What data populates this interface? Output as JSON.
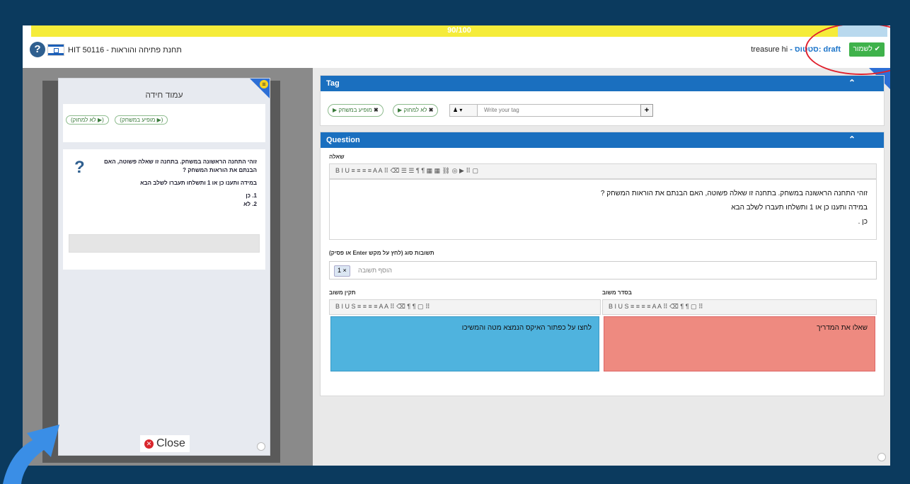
{
  "progress": {
    "text": "90/100",
    "value": 0.9
  },
  "header": {
    "hit_title": "HIT תחנת פתיחה והוראות - 50116",
    "status_prefix": "treasure hi",
    "status_draft": " - סטטוס: draft",
    "save_label": "לשמור ✔"
  },
  "preview": {
    "title": "עמוד חידה",
    "tag_pills": [
      "(לא למחוק ▶)",
      "(מופיע במשחק ▶)"
    ],
    "question_lines": [
      "זוהי התחנה הראשונה במשחק. בתחנה זו שאלה פשוטה, האם הבנתם את הוראות המשחק ?",
      "במידה ותענו כן או 1 ותשלחו תעברו לשלב הבא",
      "1. כן",
      "2. לא"
    ],
    "close_label": "Close"
  },
  "tag_panel": {
    "header": "Tag",
    "pills": [
      "מופיע במשחק",
      "לא למחוק"
    ],
    "input_placeholder": "Write your tag",
    "add_label": "+"
  },
  "question_panel": {
    "header": "Question",
    "question_label": "שאלה",
    "toolbar": "B  I  U  ≡ ≡ ≡ ≡   A  A  ⠿  ⌫   ☰  ☰   ¶  ¶   ▦  ▦  ⛓  ◎  ▶  ⠿  ▢",
    "question_lines": [
      "זוהי התחנה הראשונה במשחק. בתחנה זו שאלה פשוטה, האם הבנתם את הוראות המשחק ?",
      "במידה ותענו כן או 1 ותשלחו תעברו לשלב הבא",
      "כן ."
    ],
    "answers_label": "(או פסיק Enter לחץ על מקש) תשובות סוג",
    "answer_chip": "1 ×",
    "answer_placeholder": "הוסף תשובה",
    "correct_label": "בסדר משוב",
    "wrong_label": "תקין משוב",
    "correct_text": "שאלו את המדריך",
    "wrong_text": "לחצו על כפתור האיקס הנמצא מטה והמשיכו",
    "mini_toolbar": "B  I  U  S   ≡ ≡ ≡ ≡   A  A  ⠿  ⌫   ¶  ¶   ▢  ⠿"
  },
  "colors": {
    "accent": "#1a6fbf",
    "save": "#3fb24b",
    "progress": "#f5ec3a",
    "correct_feedback": "#ee8a80",
    "wrong_feedback": "#4fb3de"
  }
}
